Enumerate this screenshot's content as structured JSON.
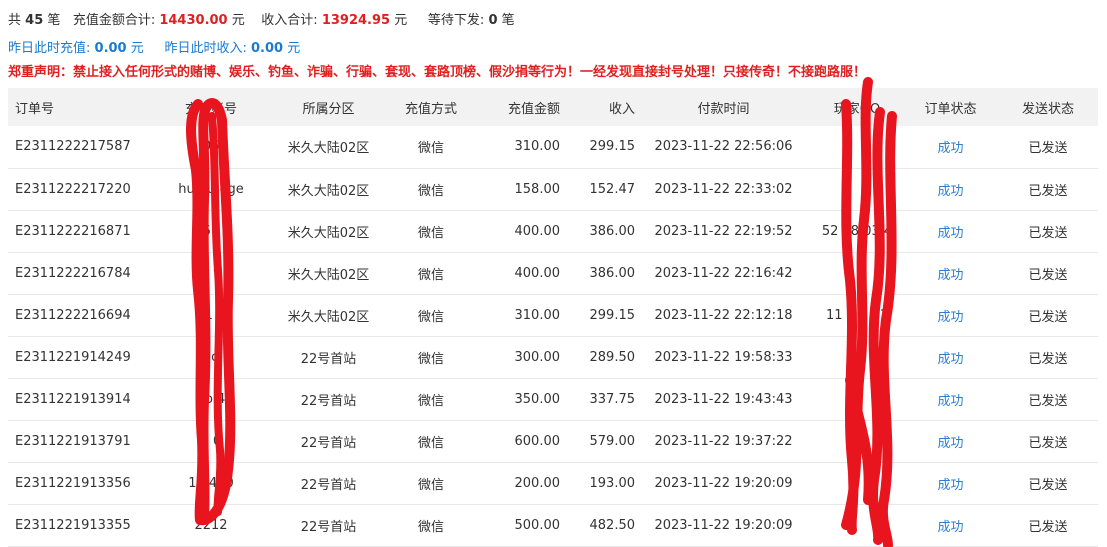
{
  "summary": {
    "count_prefix": "共",
    "count": "45",
    "count_suffix": "笔",
    "recharge_label": "充值金额合计:",
    "recharge_total": "14430.00",
    "recharge_unit": "元",
    "income_label": "收入合计:",
    "income_total": "13924.95",
    "income_unit": "元",
    "pending_label": "等待下发:",
    "pending": "0",
    "pending_unit": "笔"
  },
  "yesterday": {
    "recharge_label": "昨日此时充值:",
    "recharge_value": "0.00",
    "recharge_unit": "元",
    "income_label": "昨日此时收入:",
    "income_value": "0.00",
    "income_unit": "元"
  },
  "notice": "郑重声明：禁止接入任何形式的赌博、娱乐、钓鱼、诈骗、行骗、套现、套路顶榜、假沙捐等行为！一经发现直接封号处理！只接传奇！不接跑路服！",
  "table": {
    "headers": [
      "订单号",
      "充值账号",
      "所属分区",
      "充值方式",
      "充值金额",
      "收入",
      "付款时间",
      "玩家QQ",
      "订单状态",
      "发送状态"
    ],
    "rows": [
      {
        "order": "E2311222217587",
        "account": "06",
        "zone": "米久大陆02区",
        "method": "微信",
        "amount": "310.00",
        "income": "299.15",
        "time": "2023-11-22 22:56:06",
        "qq": "",
        "status": "成功",
        "send": "已发送"
      },
      {
        "order": "E2311222217220",
        "account": "hu hu ege",
        "zone": "米久大陆02区",
        "method": "微信",
        "amount": "158.00",
        "income": "152.47",
        "time": "2023-11-22 22:33:02",
        "qq": "",
        "status": "成功",
        "send": "已发送"
      },
      {
        "order": "E2311222216871",
        "account": "56",
        "zone": "米久大陆02区",
        "method": "微信",
        "amount": "400.00",
        "income": "386.00",
        "time": "2023-11-22 22:19:52",
        "qq": "52 48 03 4",
        "status": "成功",
        "send": "已发送"
      },
      {
        "order": "E2311222216784",
        "account": "5 9",
        "zone": "米久大陆02区",
        "method": "微信",
        "amount": "400.00",
        "income": "386.00",
        "time": "2023-11-22 22:16:42",
        "qq": "",
        "status": "成功",
        "send": "已发送"
      },
      {
        "order": "E2311222216694",
        "account": "a1 0",
        "zone": "米久大陆02区",
        "method": "微信",
        "amount": "310.00",
        "income": "299.15",
        "time": "2023-11-22 22:12:18",
        "qq": "11 8 8 21",
        "status": "成功",
        "send": "已发送"
      },
      {
        "order": "E2311221914249",
        "account": "qo",
        "zone": "22号首站",
        "method": "微信",
        "amount": "300.00",
        "income": "289.50",
        "time": "2023-11-22 19:58:33",
        "qq": "",
        "status": "成功",
        "send": "已发送"
      },
      {
        "order": "E2311221913914",
        "account": "qo 4",
        "zone": "22号首站",
        "method": "微信",
        "amount": "350.00",
        "income": "337.75",
        "time": "2023-11-22 19:43:43",
        "qq": "",
        "status": "成功",
        "send": "已发送"
      },
      {
        "order": "E2311221913791",
        "account": "6 0",
        "zone": "22号首站",
        "method": "微信",
        "amount": "600.00",
        "income": "579.00",
        "time": "2023-11-22 19:37:22",
        "qq": "",
        "status": "成功",
        "send": "已发送"
      },
      {
        "order": "E2311221913356",
        "account": "12 430",
        "zone": "22号首站",
        "method": "微信",
        "amount": "200.00",
        "income": "193.00",
        "time": "2023-11-22 19:20:09",
        "qq": "",
        "status": "成功",
        "send": "已发送"
      },
      {
        "order": "E2311221913355",
        "account": "2212",
        "zone": "22号首站",
        "method": "微信",
        "amount": "500.00",
        "income": "482.50",
        "time": "2023-11-22 19:20:09",
        "qq": "",
        "status": "成功",
        "send": "已发送"
      }
    ]
  },
  "colors": {
    "accent_red": "#e02020",
    "accent_blue": "#1a7bd0",
    "status_blue": "#2a7fd4",
    "scribble_red": "#e8141e",
    "header_bg": "#f2f2f2"
  }
}
